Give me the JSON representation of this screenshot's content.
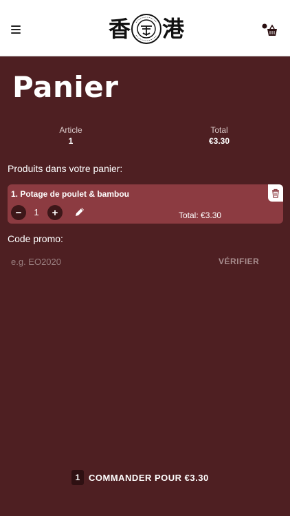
{
  "header": {
    "logo_char_left": "香",
    "logo_char_right": "港",
    "logo_seal_text": "HONG KONG EXPRESS",
    "menu_icon": "hamburger-menu-icon",
    "cart_icon": "basket-icon"
  },
  "page": {
    "title": "Panier"
  },
  "summary": {
    "article_label": "Article",
    "article_value": "1",
    "total_label": "Total",
    "total_value": "€3.30"
  },
  "cart": {
    "section_label": "Produits dans votre panier:",
    "items": [
      {
        "name": "1. Potage de poulet & bambou",
        "quantity": "1",
        "minus_label": "−",
        "plus_label": "+",
        "total": "Total: €3.30"
      }
    ]
  },
  "promo": {
    "label": "Code promo:",
    "placeholder": "e.g. EO2020",
    "verify_label": "VÉRIFIER"
  },
  "order": {
    "count": "1",
    "label": "COMMANDER POUR €3.30"
  },
  "colors": {
    "background": "#4e1f22",
    "card": "#8c3b41",
    "header": "#ffffff"
  }
}
